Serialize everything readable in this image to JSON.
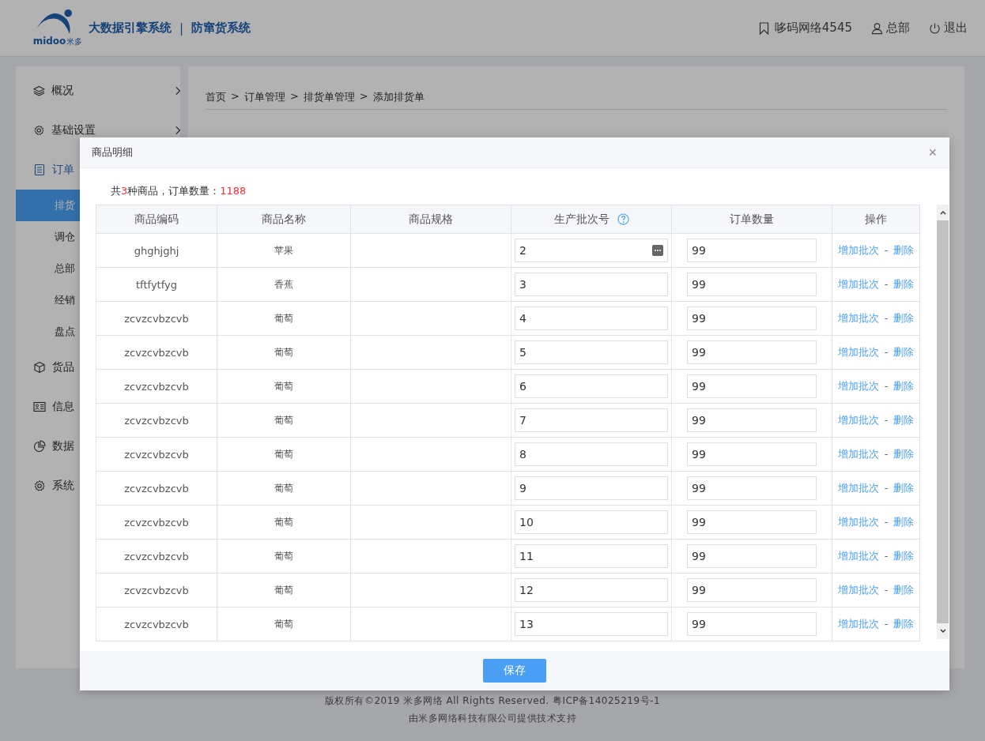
{
  "header": {
    "logo": {
      "word": "midoo",
      "mark": "米多"
    },
    "title": "大数据引擎系统",
    "separator": "|",
    "subtitle": "防窜货系统",
    "account": "哆码网络4545",
    "user": "总部",
    "logout": "退出"
  },
  "sidebar": {
    "items": [
      {
        "label": "概况",
        "expandable": true,
        "selected": false
      },
      {
        "label": "基础设置",
        "expandable": true,
        "selected": false
      },
      {
        "label": "订单",
        "expandable": false,
        "selected": true,
        "children": [
          {
            "label": "排货",
            "selected": true
          },
          {
            "label": "调仓",
            "selected": false
          },
          {
            "label": "总部",
            "selected": false
          },
          {
            "label": "经销",
            "selected": false
          },
          {
            "label": "盘点",
            "selected": false
          }
        ]
      },
      {
        "label": "货品",
        "expandable": false,
        "selected": false
      },
      {
        "label": "信息",
        "expandable": false,
        "selected": false
      },
      {
        "label": "数据",
        "expandable": false,
        "selected": false
      },
      {
        "label": "系统",
        "expandable": false,
        "selected": false
      }
    ]
  },
  "breadcrumb": [
    "首页",
    ">",
    "订单管理",
    ">",
    "排货单管理",
    ">",
    "添加排货单"
  ],
  "footer": [
    "版权所有©2019 米多网络 All Rights Reserved. 粤ICP备14025219号-1",
    "由米多网络科技有限公司提供技术支持"
  ],
  "dialog": {
    "title": "商品明细",
    "close": "×",
    "summary": {
      "prefix": "共",
      "kinds": "3",
      "middle": "种商品，订单数量：",
      "total": "1188"
    },
    "columns": [
      "商品编码",
      "商品名称",
      "商品规格",
      "生产批次号",
      "订单数量",
      "操作"
    ],
    "rows": [
      {
        "code": "ghghjghj",
        "name": "苹果",
        "batch": "2",
        "qty": "99",
        "picker": true,
        "add": "增加批次",
        "sep": "-",
        "del": "删除"
      },
      {
        "code": "tftfytfyg",
        "name": "香蕉",
        "batch": "3",
        "qty": "99",
        "picker": false,
        "add": "增加批次",
        "sep": "-",
        "del": "删除"
      },
      {
        "code": "zcvzcvbzcvb",
        "name": "葡萄",
        "batch": "4",
        "qty": "99",
        "picker": false,
        "add": "增加批次",
        "sep": "-",
        "del": "删除"
      },
      {
        "code": "zcvzcvbzcvb",
        "name": "葡萄",
        "batch": "5",
        "qty": "99",
        "picker": false,
        "add": "增加批次",
        "sep": "-",
        "del": "删除"
      },
      {
        "code": "zcvzcvbzcvb",
        "name": "葡萄",
        "batch": "6",
        "qty": "99",
        "picker": false,
        "add": "增加批次",
        "sep": "-",
        "del": "删除"
      },
      {
        "code": "zcvzcvbzcvb",
        "name": "葡萄",
        "batch": "7",
        "qty": "99",
        "picker": false,
        "add": "增加批次",
        "sep": "-",
        "del": "删除"
      },
      {
        "code": "zcvzcvbzcvb",
        "name": "葡萄",
        "batch": "8",
        "qty": "99",
        "picker": false,
        "add": "增加批次",
        "sep": "-",
        "del": "删除"
      },
      {
        "code": "zcvzcvbzcvb",
        "name": "葡萄",
        "batch": "9",
        "qty": "99",
        "picker": false,
        "add": "增加批次",
        "sep": "-",
        "del": "删除"
      },
      {
        "code": "zcvzcvbzcvb",
        "name": "葡萄",
        "batch": "10",
        "qty": "99",
        "picker": false,
        "add": "增加批次",
        "sep": "-",
        "del": "删除"
      },
      {
        "code": "zcvzcvbzcvb",
        "name": "葡萄",
        "batch": "11",
        "qty": "99",
        "picker": false,
        "add": "增加批次",
        "sep": "-",
        "del": "删除"
      },
      {
        "code": "zcvzcvbzcvb",
        "name": "葡萄",
        "batch": "12",
        "qty": "99",
        "picker": false,
        "add": "增加批次",
        "sep": "-",
        "del": "删除"
      },
      {
        "code": "zcvzcvbzcvb",
        "name": "葡萄",
        "batch": "13",
        "qty": "99",
        "picker": false,
        "add": "增加批次",
        "sep": "-",
        "del": "删除"
      }
    ],
    "save": "保存"
  }
}
